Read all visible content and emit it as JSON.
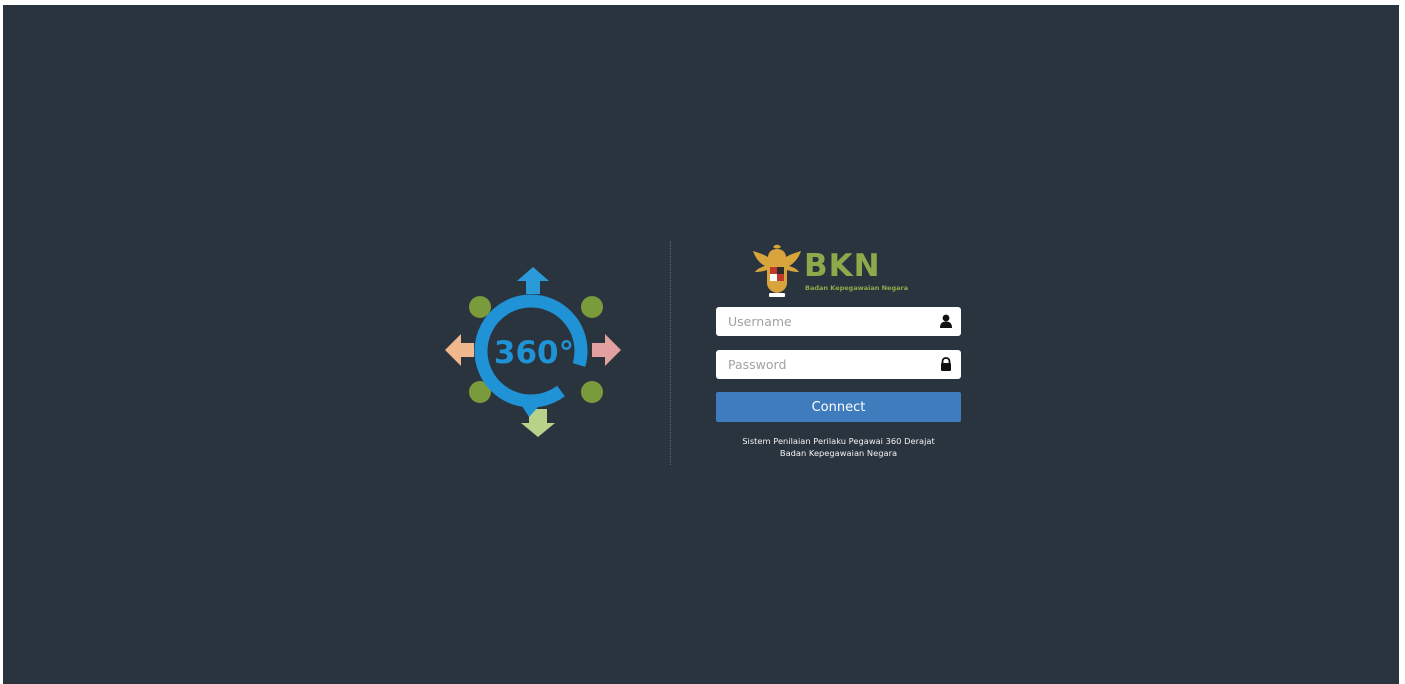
{
  "brand": {
    "title": "BKN",
    "subtitle": "Badan Kepegawaian Negara",
    "emblem_icon": "garuda-emblem-icon",
    "accent_color": "#8fa94a"
  },
  "logo360": {
    "label": "360°",
    "icon": "360-degree-icon"
  },
  "login": {
    "username": {
      "placeholder": "Username",
      "value": "",
      "icon": "user-icon"
    },
    "password": {
      "placeholder": "Password",
      "value": "",
      "icon": "lock-icon"
    },
    "connect_label": "Connect",
    "button_color": "#3e7cbd"
  },
  "footer": {
    "line1": "Sistem Penilaian Perilaku Pegawai 360 Derajat",
    "line2": "Badan Kepegawaian Negara"
  },
  "colors": {
    "background": "#2a343f"
  }
}
